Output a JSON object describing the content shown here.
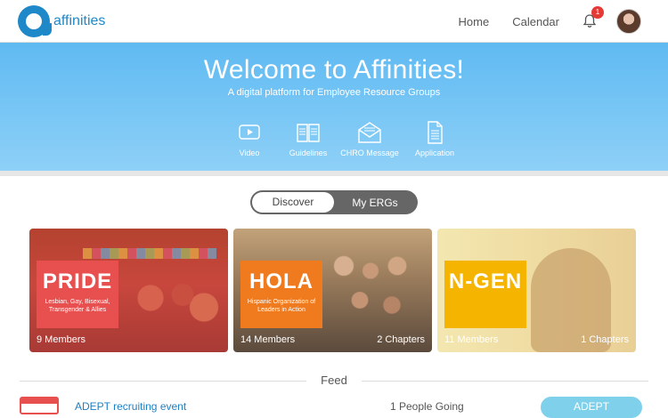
{
  "app": {
    "logo_text": "affinities"
  },
  "nav": {
    "items": [
      "Home",
      "Calendar"
    ],
    "notification_count": "1"
  },
  "hero": {
    "title": "Welcome to Affinities!",
    "subtitle": "A digital platform for Employee Resource Groups",
    "links": [
      {
        "label": "Video",
        "icon": "video-icon"
      },
      {
        "label": "Guidelines",
        "icon": "book-icon"
      },
      {
        "label": "CHRO Message",
        "icon": "envelope-icon"
      },
      {
        "label": "Application",
        "icon": "document-icon"
      }
    ]
  },
  "toggle": {
    "active": "Discover",
    "inactive": "My ERGs"
  },
  "cards": [
    {
      "name": "PRIDE",
      "desc": "Lesbian, Gay, Bisexual, Transgender & Allies",
      "members": "9 Members",
      "chapters": "",
      "color": "#e84f4f"
    },
    {
      "name": "HOLA",
      "desc": "Hispanic Organization of Leaders in Action",
      "members": "14 Members",
      "chapters": "2 Chapters",
      "color": "#f07a1e"
    },
    {
      "name": "N-GEN",
      "desc": "",
      "members": "11 Members",
      "chapters": "1 Chapters",
      "color": "#f5b400"
    }
  ],
  "feed": {
    "title": "Feed",
    "event": {
      "title": "ADEPT recruiting event",
      "going": "1 People Going",
      "group": "ADEPT"
    }
  }
}
